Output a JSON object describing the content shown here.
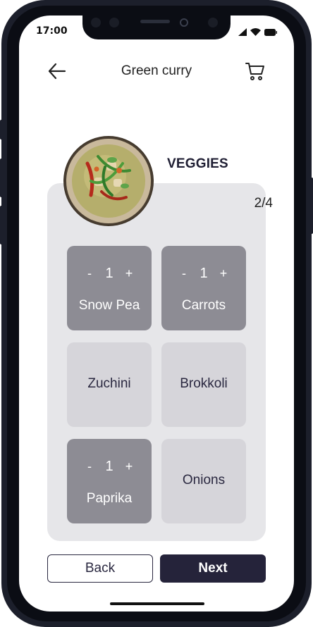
{
  "status_bar": {
    "time": "17:00",
    "icons": [
      "signal-icon",
      "wifi-icon",
      "battery-icon"
    ]
  },
  "header": {
    "title": "Green curry",
    "back_icon": "arrow-left-icon",
    "cart_icon": "cart-icon"
  },
  "section": {
    "title": "VEGGIES",
    "progress": "2/4"
  },
  "items": [
    {
      "name": "Snow Pea",
      "selected": true,
      "quantity": "1"
    },
    {
      "name": "Carrots",
      "selected": true,
      "quantity": "1"
    },
    {
      "name": "Zuchini",
      "selected": false
    },
    {
      "name": "Brokkoli",
      "selected": false
    },
    {
      "name": "Paprika",
      "selected": true,
      "quantity": "1"
    },
    {
      "name": "Onions",
      "selected": false
    }
  ],
  "qty_controls": {
    "minus": "-",
    "plus": "+"
  },
  "footer": {
    "back_label": "Back",
    "next_label": "Next"
  },
  "colors": {
    "accent": "#25233a",
    "tile_selected": "#8d8c94",
    "tile_default": "#d6d5da",
    "card_bg": "#e6e6e9"
  }
}
